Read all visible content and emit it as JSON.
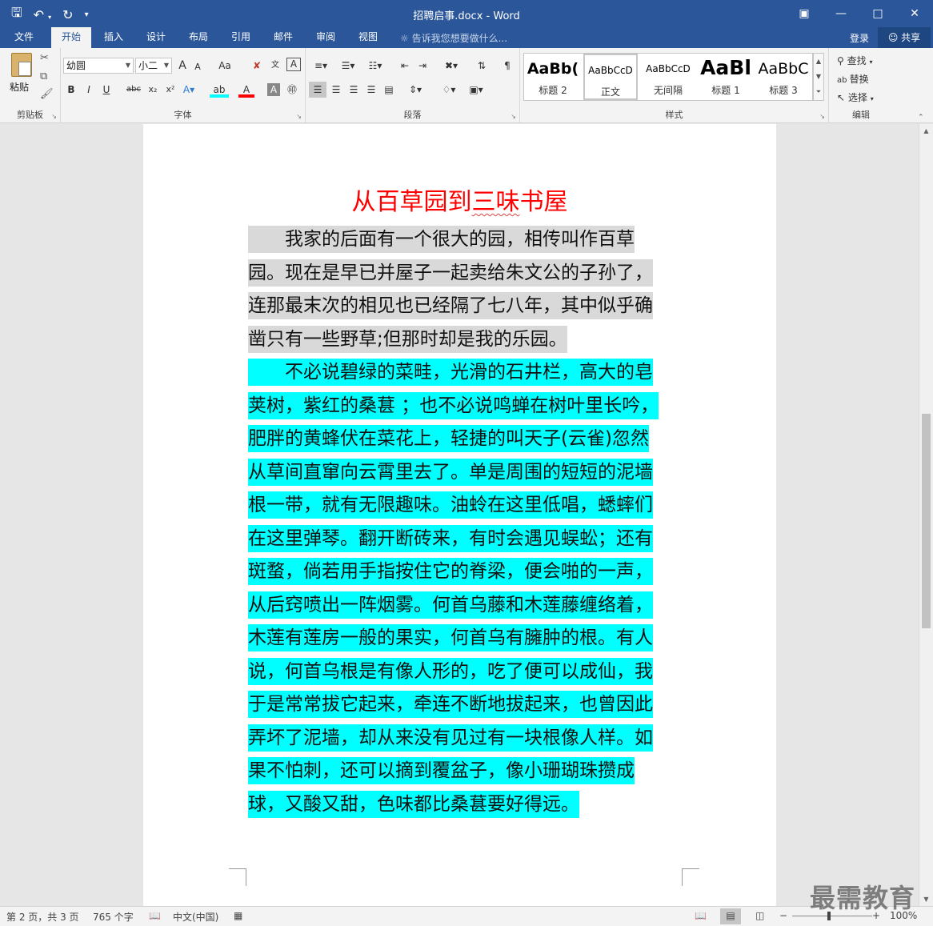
{
  "window": {
    "title": "招聘启事.docx - Word",
    "qat_icons": [
      "save-icon",
      "undo-icon",
      "redo-icon",
      "customize-icon"
    ],
    "controls": [
      "ribbon-display-icon",
      "minimize-icon",
      "maximize-icon",
      "close-icon"
    ]
  },
  "tabs": [
    "文件",
    "开始",
    "插入",
    "设计",
    "布局",
    "引用",
    "邮件",
    "审阅",
    "视图"
  ],
  "active_tab": "开始",
  "tell_me": "告诉我您想要做什么...",
  "login": "登录",
  "share": "共享",
  "ribbon": {
    "clipboard": {
      "paste": "粘贴",
      "label": "剪贴板"
    },
    "font": {
      "font_name": "幼圆",
      "font_size": "小二",
      "grow": "A",
      "shrink": "A",
      "case": "Aa",
      "bold": "B",
      "italic": "I",
      "underline": "U",
      "strike": "abc",
      "subscript": "x₂",
      "superscript": "x²",
      "label": "字体"
    },
    "paragraph": {
      "label": "段落"
    },
    "styles": {
      "items": [
        {
          "sample": "AaBb(",
          "name": "标题 2"
        },
        {
          "sample": "AaBbCcD",
          "name": "正文"
        },
        {
          "sample": "AaBbCcD",
          "name": "无间隔"
        },
        {
          "sample": "AaBl",
          "name": "标题 1"
        },
        {
          "sample": "AaBbC",
          "name": "标题 3"
        }
      ],
      "label": "样式"
    },
    "editing": {
      "find": "查找",
      "replace": "替换",
      "select": "选择",
      "label": "编辑"
    }
  },
  "document": {
    "title_parts": [
      "从百草园到",
      "三味",
      "书屋"
    ],
    "para1": [
      "　　我家的后面有一个很大的园，相传叫作百草",
      "园。现在是早已并屋子一起卖给朱文公的子孙了，",
      "连那最末次的相见也已经隔了七八年，其中似乎确",
      "凿只有一些野草;但那时却是我的乐园。"
    ],
    "para2": [
      "　　不必说碧绿的菜畦，光滑的石井栏，高大的皂",
      "荚树，紫红的桑葚 ；也不必说鸣蝉在树叶里长吟，",
      "肥胖的黄蜂伏在菜花上，轻捷的叫天子(云雀)忽然",
      "从草间直窜向云霄里去了。单是周围的短短的泥墙",
      "根一带，就有无限趣味。油蛉在这里低唱，蟋蟀们",
      "在这里弹琴。翻开断砖来，有时会遇见蜈蚣；还有",
      "斑蝥，倘若用手指按住它的脊梁，便会啪的一声，",
      "从后窍喷出一阵烟雾。何首乌藤和木莲藤缠络着，",
      "木莲有莲房一般的果实，何首乌有臃肿的根。有人",
      "说，何首乌根是有像人形的，吃了便可以成仙，我",
      "于是常常拔它起来，牵连不断地拔起来，也曾因此",
      "弄坏了泥墙，却从来没有见过有一块根像人样。如",
      "果不怕刺，还可以摘到覆盆子，像小珊瑚珠攒成",
      "球，又酸又甜，色味都比桑葚要好得远。"
    ]
  },
  "status": {
    "page": "第 2 页，共 3 页",
    "words": "765 个字",
    "language": "中文(中国)",
    "zoom": "100%"
  },
  "watermark": "最需教育",
  "colors": {
    "accent": "#2b579a",
    "title_red": "#ff0000",
    "highlight_gray": "#d9d9d9",
    "highlight_cyan": "#00ffff"
  }
}
